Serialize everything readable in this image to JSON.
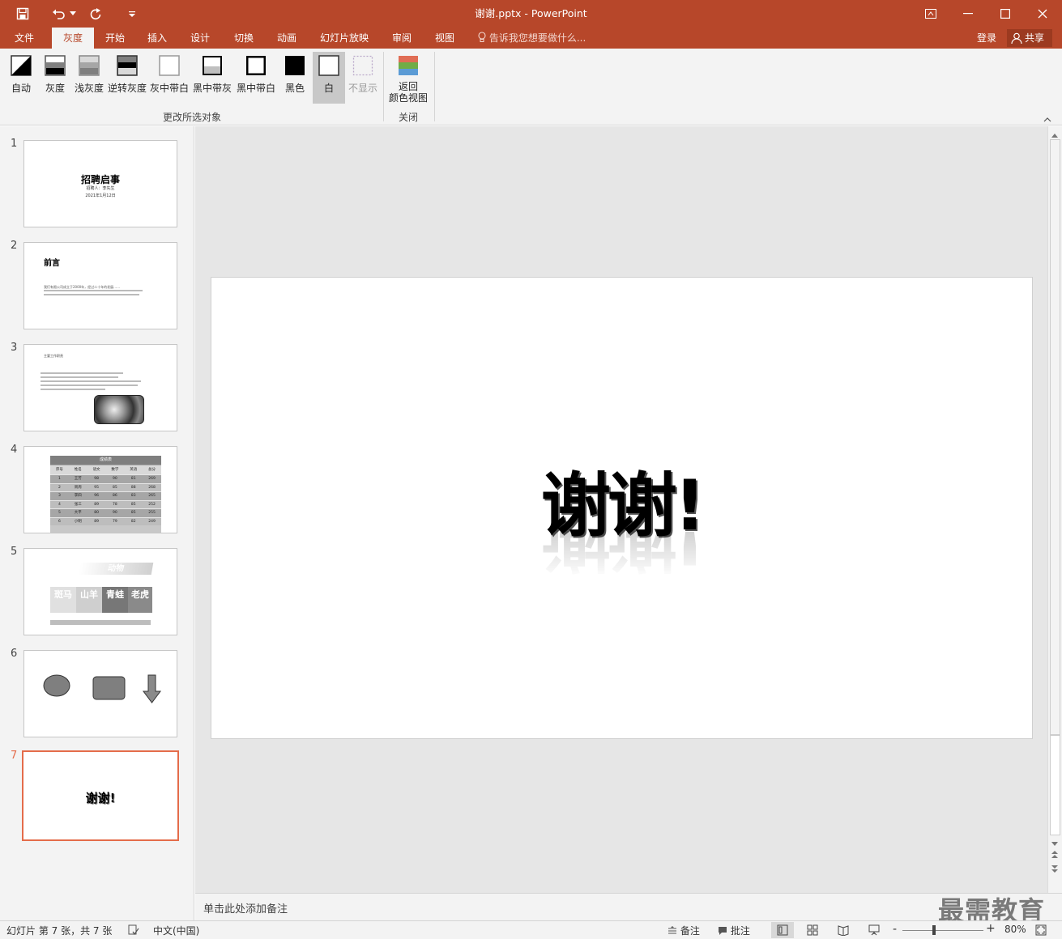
{
  "window": {
    "title": "谢谢.pptx - PowerPoint"
  },
  "tabs": [
    {
      "label": "文件"
    },
    {
      "label": "灰度"
    },
    {
      "label": "开始"
    },
    {
      "label": "插入"
    },
    {
      "label": "设计"
    },
    {
      "label": "切换"
    },
    {
      "label": "动画"
    },
    {
      "label": "幻灯片放映"
    },
    {
      "label": "审阅"
    },
    {
      "label": "视图"
    }
  ],
  "tell_me": "告诉我您想要做什么...",
  "signin": "登录",
  "share": "共享",
  "ribbon": {
    "buttons": [
      {
        "label": "自动"
      },
      {
        "label": "灰度"
      },
      {
        "label": "浅灰度"
      },
      {
        "label": "逆转灰度"
      },
      {
        "label": "灰中带白"
      },
      {
        "label": "黑中带灰"
      },
      {
        "label": "黑中带白"
      },
      {
        "label": "黑色"
      },
      {
        "label": "白"
      },
      {
        "label": "不显示"
      }
    ],
    "group1_label": "更改所选对象",
    "back_button": {
      "line1": "返回",
      "line2": "颜色视图"
    },
    "group2_label": "关闭"
  },
  "thumbnails": [
    {
      "num": "1",
      "title": "招聘启事",
      "sub": "招聘人：李先生",
      "date": "2021年1月12日"
    },
    {
      "num": "2",
      "title": "前言",
      "body": "我们有限公司成立于2000年，经过二十年的发展……"
    },
    {
      "num": "3",
      "heading": "主要工作职责"
    },
    {
      "num": "4",
      "table_title": "成绩表",
      "headers": [
        "序号",
        "姓名",
        "语文",
        "数学",
        "英语",
        "总分"
      ],
      "rows": [
        [
          "1",
          "王芳",
          "98",
          "90",
          "81",
          "269"
        ],
        [
          "2",
          "周周",
          "95",
          "85",
          "88",
          "268"
        ],
        [
          "3",
          "李四",
          "96",
          "86",
          "83",
          "265"
        ],
        [
          "4",
          "张三",
          "89",
          "78",
          "85",
          "252"
        ],
        [
          "5",
          "大平",
          "80",
          "90",
          "85",
          "255"
        ],
        [
          "6",
          "小明",
          "89",
          "79",
          "82",
          "249"
        ]
      ]
    },
    {
      "num": "5",
      "banner": "动物",
      "cells": [
        "斑马",
        "山羊",
        "青蛙",
        "老虎"
      ]
    },
    {
      "num": "6"
    },
    {
      "num": "7",
      "text": "谢谢!"
    }
  ],
  "slide": {
    "main_text": "谢谢!"
  },
  "notes_placeholder": "单击此处添加备注",
  "status": {
    "slide_info": "幻灯片 第 7 张，共 7 张",
    "language": "中文(中国)",
    "notes_btn": "备注",
    "comments_btn": "批注",
    "zoom": "80%"
  },
  "watermark": "最需教育"
}
